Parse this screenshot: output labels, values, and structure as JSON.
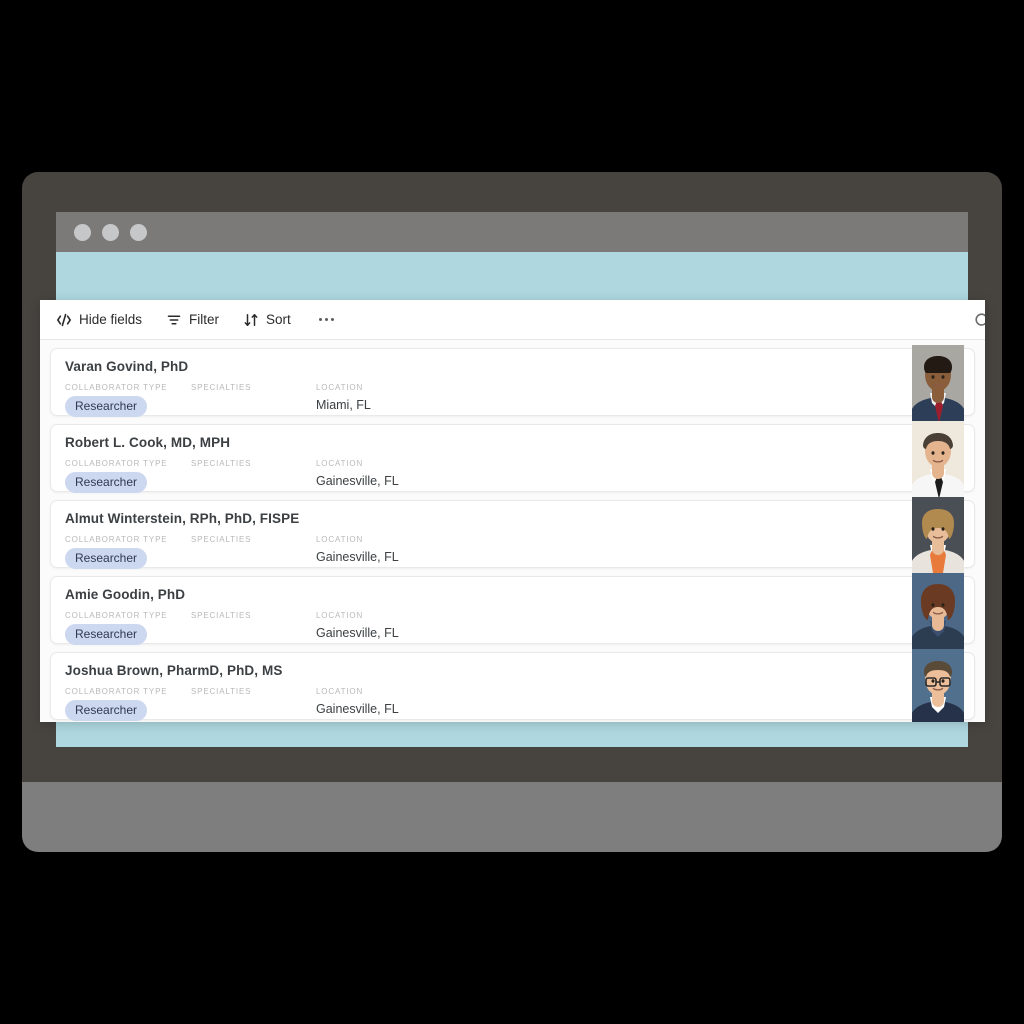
{
  "window": {
    "dot_count": 3,
    "page_bg": "#aed7e0",
    "titlebar_bg": "#7b7a79"
  },
  "toolbar": {
    "hide_fields_label": "Hide fields",
    "filter_label": "Filter",
    "sort_label": "Sort",
    "more_label": "...",
    "search_label": "Search"
  },
  "columns": {
    "collaborator_type": "COLLABORATOR TYPE",
    "specialties": "SPECIALTIES",
    "location": "LOCATION"
  },
  "accent": {
    "badge_bg": "#ccd8f0",
    "badge_text": "#2f3a52",
    "page_blue": "#aed7e0"
  },
  "records": [
    {
      "name": "Varan Govind, PhD",
      "collaborator_type": "Researcher",
      "specialties": "",
      "location": "Miami, FL",
      "photo": {
        "bg": "#a9a7a2",
        "skin": "#8a5d3b",
        "hair": "#241a14",
        "garment": "#2d3f58",
        "shirt": "#f2f2f2",
        "tie": "#9c1f2e"
      }
    },
    {
      "name": "Robert L. Cook, MD, MPH",
      "collaborator_type": "Researcher",
      "specialties": "",
      "location": "Gainesville, FL",
      "photo": {
        "bg": "#efe9dd",
        "skin": "#e4b48f",
        "hair": "#4a4036",
        "garment": "#f6f6f6",
        "shirt": "#ffffff",
        "tie": "#1c1c1c"
      }
    },
    {
      "name": "Almut Winterstein, RPh, PhD, FISPE",
      "collaborator_type": "Researcher",
      "specialties": "",
      "location": "Gainesville, FL",
      "photo": {
        "bg": "#4a4f55",
        "skin": "#e8bd99",
        "hair": "#b08a4e",
        "garment": "#e8e4dd",
        "shirt": "#ffffff",
        "tie": "#e87a3c"
      }
    },
    {
      "name": "Amie Goodin, PhD",
      "collaborator_type": "Researcher",
      "specialties": "",
      "location": "Gainesville, FL",
      "photo": {
        "bg": "#4d6886",
        "skin": "#e7b995",
        "hair": "#6b3a22",
        "garment": "#2c3d52",
        "shirt": "#3b5070",
        "tie": "#2c3d52"
      }
    },
    {
      "name": "Joshua Brown, PharmD, PhD, MS",
      "collaborator_type": "Researcher",
      "specialties": "",
      "location": "Gainesville, FL",
      "photo": {
        "bg": "#51708e",
        "skin": "#ecbe99",
        "hair": "#5a4a38",
        "garment": "#25324a",
        "shirt": "#ffffff",
        "tie": "#25324a"
      }
    }
  ]
}
